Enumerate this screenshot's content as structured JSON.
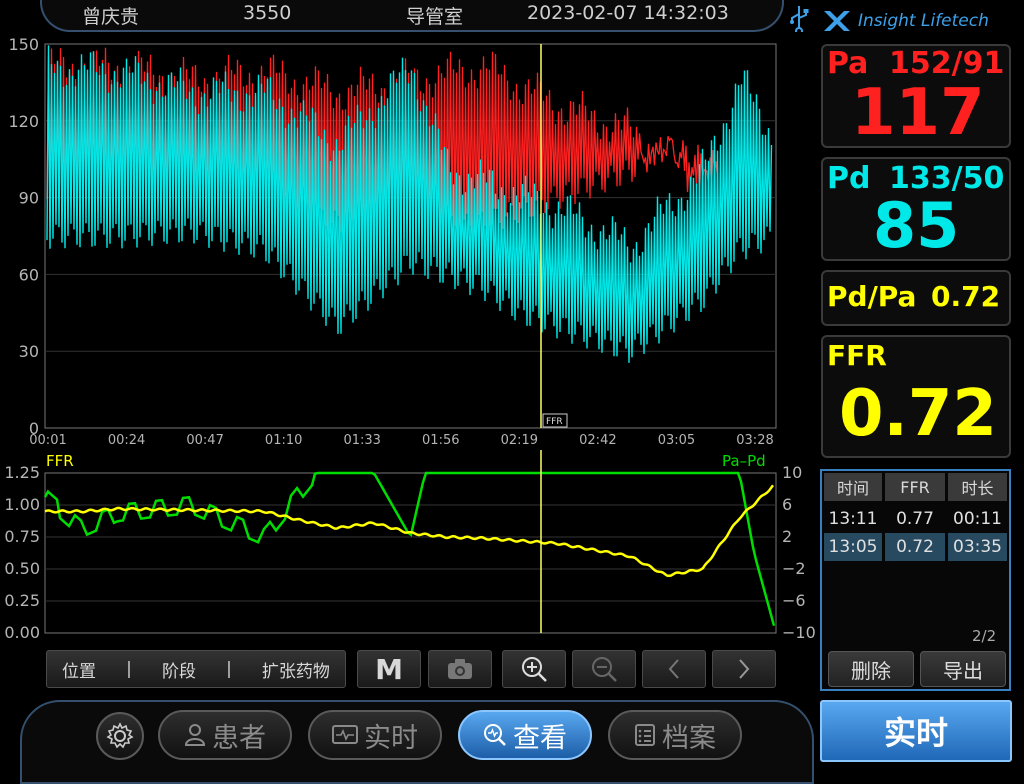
{
  "header": {
    "patient_name": "曾庆贵",
    "patient_id": "3550",
    "room": "导管室",
    "datetime": "2023-02-07 14:32:03",
    "brand": "Insight Lifetech"
  },
  "readings": {
    "pa": {
      "label": "Pa",
      "sys_dia": "152/91",
      "mean": "117"
    },
    "pd": {
      "label": "Pd",
      "sys_dia": "133/50",
      "mean": "85"
    },
    "pdpa": {
      "label": "Pd/Pa",
      "value": "0.72"
    },
    "ffr": {
      "label": "FFR",
      "value": "0.72"
    }
  },
  "colors": {
    "pa": "#ff2020",
    "pd": "#00e8e8",
    "ffr": "#ffff00",
    "green": "#00dd00",
    "accent": "#3da0e8"
  },
  "pressure_chart": {
    "y_ticks": [
      "150",
      "120",
      "90",
      "60",
      "30",
      "0"
    ],
    "x_ticks": [
      "00:01",
      "00:24",
      "00:47",
      "01:10",
      "01:33",
      "01:56",
      "02:19",
      "02:42",
      "03:05",
      "03:28"
    ],
    "marker_label": "FFR"
  },
  "ffr_chart": {
    "left_label": "FFR",
    "right_label": "Pa–Pd",
    "left_ticks": [
      "1.25",
      "1.00",
      "0.75",
      "0.50",
      "0.25",
      "0.00"
    ],
    "right_ticks": [
      "10",
      "6",
      "2",
      "−2",
      "−6",
      "−10"
    ]
  },
  "chart_data": [
    {
      "type": "line",
      "xlabel": "",
      "ylabel": "",
      "ylim": [
        0,
        150
      ],
      "x_tick_labels": [
        "00:01",
        "00:24",
        "00:47",
        "01:10",
        "01:33",
        "01:56",
        "02:19",
        "02:42",
        "03:05",
        "03:28"
      ],
      "series": [
        {
          "color": "#ff2020",
          "x": [
            0,
            0.1,
            0.2,
            0.3,
            0.4,
            0.5,
            0.6,
            0.7,
            0.8,
            0.85,
            0.92
          ],
          "y_max": [
            150,
            150,
            145,
            148,
            140,
            145,
            150,
            135,
            125,
            115,
            100
          ],
          "y_min": [
            80,
            85,
            85,
            82,
            75,
            70,
            75,
            85,
            95,
            105,
            98
          ]
        },
        {
          "color": "#00e8e8",
          "x": [
            0,
            0.1,
            0.2,
            0.3,
            0.4,
            0.5,
            0.55,
            0.6,
            0.65,
            0.7,
            0.8,
            0.9,
            0.95,
            1.0
          ],
          "y_max": [
            150,
            148,
            140,
            140,
            120,
            150,
            110,
            105,
            100,
            95,
            80,
            110,
            145,
            120
          ],
          "y_min": [
            70,
            70,
            72,
            65,
            35,
            60,
            55,
            50,
            40,
            35,
            25,
            45,
            65,
            70
          ]
        }
      ]
    },
    {
      "type": "line",
      "xlabel": "",
      "ylabel": "",
      "ylim_left": [
        0,
        1.25
      ],
      "ylim_right": [
        -10,
        10
      ],
      "series": [
        {
          "name": "FFR",
          "color": "#ffff00",
          "x": [
            0,
            0.05,
            0.1,
            0.2,
            0.3,
            0.35,
            0.4,
            0.45,
            0.5,
            0.55,
            0.6,
            0.7,
            0.8,
            0.85,
            0.9,
            0.95,
            1.0
          ],
          "y": [
            0.95,
            0.95,
            0.97,
            0.96,
            0.95,
            0.88,
            0.82,
            0.86,
            0.78,
            0.75,
            0.74,
            0.7,
            0.6,
            0.45,
            0.5,
            0.9,
            1.17
          ]
        },
        {
          "name": "Pa–Pd",
          "color": "#00dd00",
          "x": [
            0,
            0.05,
            0.1,
            0.2,
            0.3,
            0.37,
            0.45,
            0.5,
            0.52,
            0.6,
            0.7,
            0.8,
            0.95,
            0.97,
            1.0
          ],
          "y": [
            7,
            3,
            5,
            6,
            2,
            10,
            10,
            2,
            10,
            10,
            10,
            10,
            10,
            0,
            -10
          ]
        }
      ]
    }
  ],
  "table": {
    "headers": [
      "时间",
      "FFR",
      "时长"
    ],
    "rows": [
      {
        "time": "13:11",
        "ffr": "0.77",
        "duration": "00:11"
      },
      {
        "time": "13:05",
        "ffr": "0.72",
        "duration": "03:35"
      }
    ],
    "page": "2/2",
    "delete_label": "删除",
    "export_label": "导出"
  },
  "toolbar": {
    "position_label": "位置",
    "stage_label": "阶段",
    "drug_label": "扩张药物",
    "m_label": "M"
  },
  "nav": {
    "patient": "患者",
    "realtime": "实时",
    "review": "查看",
    "archive": "档案"
  },
  "realtime_button": "实时"
}
